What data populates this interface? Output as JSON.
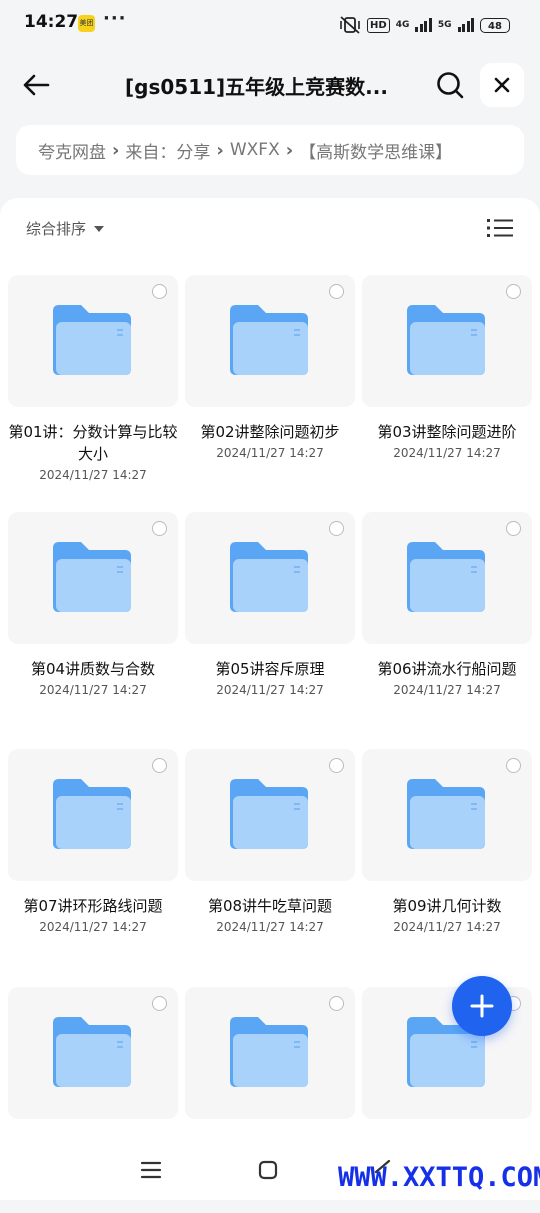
{
  "status_bar": {
    "time": "14:27",
    "app_badge": "美团",
    "more": "···",
    "hd": "HD",
    "net1": "4G",
    "net2": "5G",
    "battery": "48"
  },
  "header": {
    "title": "[gs0511]五年级上竞赛数..."
  },
  "breadcrumb": {
    "items": [
      "夸克网盘",
      "来自：分享",
      "WXFX",
      "【高斯数学思维课】"
    ]
  },
  "toolbar": {
    "sort_label": "综合排序"
  },
  "files": [
    {
      "name": "第01讲：分数计算与比较大小",
      "date": "2024/11/27 14:27"
    },
    {
      "name": "第02讲整除问题初步",
      "date": "2024/11/27 14:27"
    },
    {
      "name": "第03讲整除问题进阶",
      "date": "2024/11/27 14:27"
    },
    {
      "name": "第04讲质数与合数",
      "date": "2024/11/27 14:27"
    },
    {
      "name": "第05讲容斥原理",
      "date": "2024/11/27 14:27"
    },
    {
      "name": "第06讲流水行船问题",
      "date": "2024/11/27 14:27"
    },
    {
      "name": "第07讲环形路线问题",
      "date": "2024/11/27 14:27"
    },
    {
      "name": "第08讲牛吃草问题",
      "date": "2024/11/27 14:27"
    },
    {
      "name": "第09讲几何计数",
      "date": "2024/11/27 14:27"
    },
    {
      "name": "",
      "date": ""
    },
    {
      "name": "",
      "date": ""
    },
    {
      "name": "",
      "date": ""
    }
  ],
  "watermark": "WWW.XXTTQ.COM",
  "colors": {
    "accent": "#1f63ee",
    "folder_back": "#5aa6f5",
    "folder_front": "#a9d2fb"
  }
}
